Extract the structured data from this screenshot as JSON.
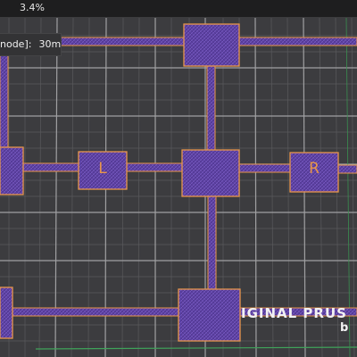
{
  "progress": {
    "text": "3.4%"
  },
  "estimate": {
    "label": "node]:",
    "value": "30m"
  },
  "bed": {
    "logo_text": "IGINAL PRUS",
    "logo_text_b": "b"
  },
  "pads": {
    "left_label": "L",
    "right_label": "R"
  },
  "colors": {
    "background": "#2b2b2d",
    "bed": "#3d3d40",
    "grid_major": "#9c9c9c",
    "grid_minor": "#5a5a5c",
    "trace": "#5b3fa0",
    "outline": "#e9964a",
    "accent_green": "#3fa35a"
  }
}
